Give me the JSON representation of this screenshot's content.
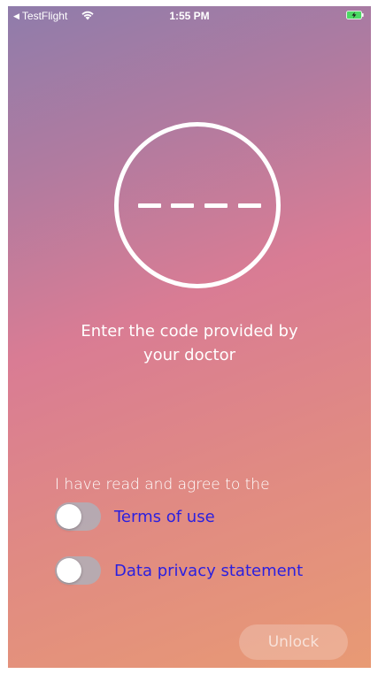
{
  "status_bar": {
    "back_app": "TestFlight",
    "time": "1:55 PM",
    "wifi_icon": "wifi-icon",
    "battery_icon": "battery-charging-icon"
  },
  "code_entry": {
    "digit_count": 4,
    "icon": "code-circle-icon"
  },
  "instruction": {
    "line1": "Enter the code provided by",
    "line2": "your doctor"
  },
  "agreement": {
    "intro": "I have read and agree to the",
    "terms_label": "Terms of use",
    "terms_on": false,
    "privacy_label": "Data privacy statement",
    "privacy_on": false
  },
  "unlock_button": {
    "label": "Unlock",
    "enabled": false
  },
  "colors": {
    "gradient_top": "#8f7cab",
    "gradient_middle": "#d97c94",
    "gradient_bottom": "#e89a74",
    "link": "#2a1fe0",
    "text": "#ffffff"
  }
}
